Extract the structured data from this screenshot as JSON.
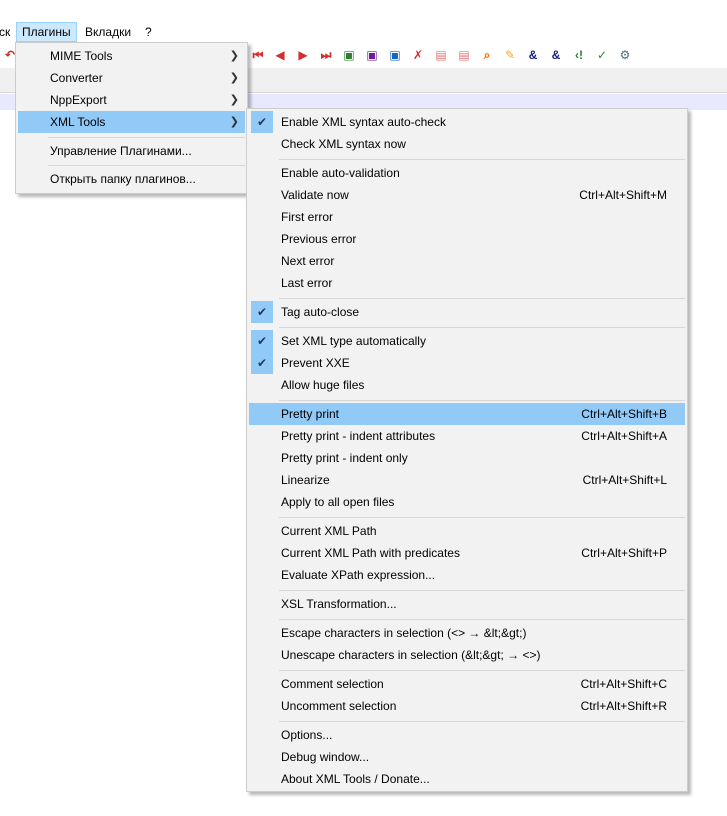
{
  "menubar": {
    "items": [
      {
        "label": "ск",
        "active": false
      },
      {
        "label": "Плагины",
        "active": true
      },
      {
        "label": "Вкладки",
        "active": false
      },
      {
        "label": "?",
        "active": false
      }
    ]
  },
  "toolbar": {
    "icons": [
      "undo-icon",
      "step-back-icon",
      "play-back-icon",
      "play-forward-icon",
      "step-forward-icon",
      "macro-save-icon",
      "macro-run-icon",
      "macro-multi-icon",
      "spellcheck-icon",
      "doc-icon",
      "doc-alt-icon",
      "preview-icon",
      "star-icon",
      "xml-escape-icon",
      "xml-unescape-icon",
      "tag-open-icon",
      "tag-close-icon",
      "settings-wrench-icon"
    ]
  },
  "plugins_menu": {
    "items": [
      {
        "label": "MIME Tools",
        "submenu": true
      },
      {
        "label": "Converter",
        "submenu": true
      },
      {
        "label": "NppExport",
        "submenu": true
      },
      {
        "label": "XML Tools",
        "submenu": true,
        "highlighted": true
      },
      {
        "label": "Управление Плагинами...",
        "submenu": false
      },
      {
        "label": "Открыть папку плагинов...",
        "submenu": false
      }
    ]
  },
  "xml_menu": {
    "items": [
      {
        "label": "Enable XML syntax auto-check",
        "checked": true,
        "shortcut": ""
      },
      {
        "label": "Check XML syntax now",
        "checked": false,
        "shortcut": ""
      },
      {
        "label": "Enable auto-validation",
        "checked": false,
        "shortcut": ""
      },
      {
        "label": "Validate now",
        "checked": false,
        "shortcut": "Ctrl+Alt+Shift+M"
      },
      {
        "label": "First error",
        "checked": false,
        "shortcut": ""
      },
      {
        "label": "Previous error",
        "checked": false,
        "shortcut": ""
      },
      {
        "label": "Next error",
        "checked": false,
        "shortcut": ""
      },
      {
        "label": "Last error",
        "checked": false,
        "shortcut": ""
      },
      {
        "label": "Tag auto-close",
        "checked": true,
        "shortcut": ""
      },
      {
        "label": "Set XML type automatically",
        "checked": true,
        "shortcut": ""
      },
      {
        "label": "Prevent XXE",
        "checked": true,
        "shortcut": ""
      },
      {
        "label": "Allow huge files",
        "checked": false,
        "shortcut": ""
      },
      {
        "label": "Pretty print",
        "checked": false,
        "shortcut": "Ctrl+Alt+Shift+B",
        "highlighted": true
      },
      {
        "label": "Pretty print - indent attributes",
        "checked": false,
        "shortcut": "Ctrl+Alt+Shift+A"
      },
      {
        "label": "Pretty print - indent only",
        "checked": false,
        "shortcut": ""
      },
      {
        "label": "Linearize",
        "checked": false,
        "shortcut": "Ctrl+Alt+Shift+L"
      },
      {
        "label": "Apply to all open files",
        "checked": false,
        "shortcut": ""
      },
      {
        "label": "Current XML Path",
        "checked": false,
        "shortcut": ""
      },
      {
        "label": "Current XML Path with predicates",
        "checked": false,
        "shortcut": "Ctrl+Alt+Shift+P"
      },
      {
        "label": "Evaluate XPath expression...",
        "checked": false,
        "shortcut": ""
      },
      {
        "label": "XSL Transformation...",
        "checked": false,
        "shortcut": ""
      },
      {
        "label": "Escape characters in selection (<> → &lt;&gt;)",
        "checked": false,
        "shortcut": ""
      },
      {
        "label": "Unescape characters in selection (&lt;&gt; → <>)",
        "checked": false,
        "shortcut": ""
      },
      {
        "label": "Comment selection",
        "checked": false,
        "shortcut": "Ctrl+Alt+Shift+C"
      },
      {
        "label": "Uncomment selection",
        "checked": false,
        "shortcut": "Ctrl+Alt+Shift+R"
      },
      {
        "label": "Options...",
        "checked": false,
        "shortcut": ""
      },
      {
        "label": "Debug window...",
        "checked": false,
        "shortcut": ""
      },
      {
        "label": "About XML Tools / Donate...",
        "checked": false,
        "shortcut": ""
      }
    ]
  }
}
